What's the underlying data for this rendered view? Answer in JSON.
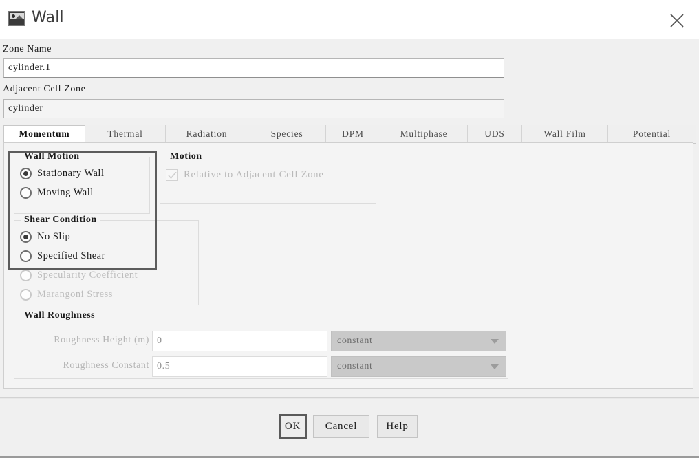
{
  "window": {
    "title": "Wall",
    "icon": "image-icon",
    "close_icon": "close-icon"
  },
  "zone": {
    "name_label": "Zone Name",
    "name_value": "cylinder.1",
    "adjacent_label": "Adjacent Cell Zone",
    "adjacent_value": "cylinder"
  },
  "tabs": [
    {
      "label": "Momentum",
      "active": true
    },
    {
      "label": "Thermal",
      "active": false
    },
    {
      "label": "Radiation",
      "active": false
    },
    {
      "label": "Species",
      "active": false
    },
    {
      "label": "DPM",
      "active": false
    },
    {
      "label": "Multiphase",
      "active": false
    },
    {
      "label": "UDS",
      "active": false
    },
    {
      "label": "Wall Film",
      "active": false
    },
    {
      "label": "Potential",
      "active": false
    }
  ],
  "wall_motion": {
    "title": "Wall Motion",
    "options": [
      {
        "label": "Stationary Wall",
        "selected": true,
        "disabled": false
      },
      {
        "label": "Moving Wall",
        "selected": false,
        "disabled": false
      }
    ]
  },
  "motion": {
    "title": "Motion",
    "checkbox_label": "Relative to Adjacent Cell Zone",
    "checked": true,
    "disabled": true
  },
  "shear_condition": {
    "title": "Shear Condition",
    "options": [
      {
        "label": "No Slip",
        "selected": true,
        "disabled": false
      },
      {
        "label": "Specified Shear",
        "selected": false,
        "disabled": false
      },
      {
        "label": "Specularity Coefficient",
        "selected": false,
        "disabled": true
      },
      {
        "label": "Marangoni Stress",
        "selected": false,
        "disabled": true
      }
    ]
  },
  "wall_roughness": {
    "title": "Wall Roughness",
    "rows": [
      {
        "label": "Roughness Height (m)",
        "value": "0",
        "method": "constant"
      },
      {
        "label": "Roughness Constant",
        "value": "0.5",
        "method": "constant"
      }
    ]
  },
  "footer": {
    "ok_label": "OK",
    "cancel_label": "Cancel",
    "help_label": "Help"
  },
  "annotation": {
    "highlight_color": "#5c5c5c"
  }
}
